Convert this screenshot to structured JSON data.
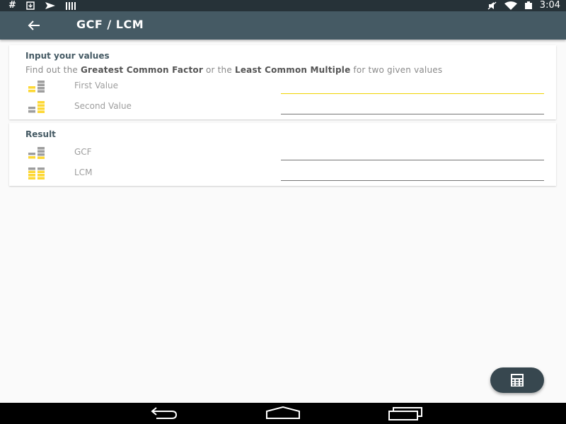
{
  "status_bar": {
    "time": "3:04",
    "left_icons": [
      "hash-icon",
      "download-icon",
      "flag-icon",
      "barcode-icon"
    ],
    "right_icons": [
      "mute-icon",
      "wifi-icon",
      "battery-icon"
    ]
  },
  "app_bar": {
    "title": "GCF / LCM",
    "back_icon": "arrow-left-icon"
  },
  "input_card": {
    "title": "Input your values",
    "description": {
      "part1": "Find out the ",
      "bold1": "Greatest Common Factor",
      "part2": " or the ",
      "bold2": "Least Common Multiple",
      "part3": " for two given values"
    },
    "first_value": {
      "label": "First Value",
      "value": ""
    },
    "second_value": {
      "label": "Second Value",
      "value": ""
    }
  },
  "result_card": {
    "title": "Result",
    "gcf": {
      "label": "GCF",
      "value": ""
    },
    "lcm": {
      "label": "LCM",
      "value": ""
    }
  },
  "fab": {
    "icon": "calculator-icon"
  },
  "nav_bar": {
    "icons": [
      "nav-back-icon",
      "nav-home-icon",
      "nav-recents-icon"
    ]
  },
  "colors": {
    "status_bar": "#263238",
    "app_bar": "#455a64",
    "accent": "#f0d400",
    "icon_yellow": "#fdd835",
    "icon_gray": "#9e9e9e"
  }
}
